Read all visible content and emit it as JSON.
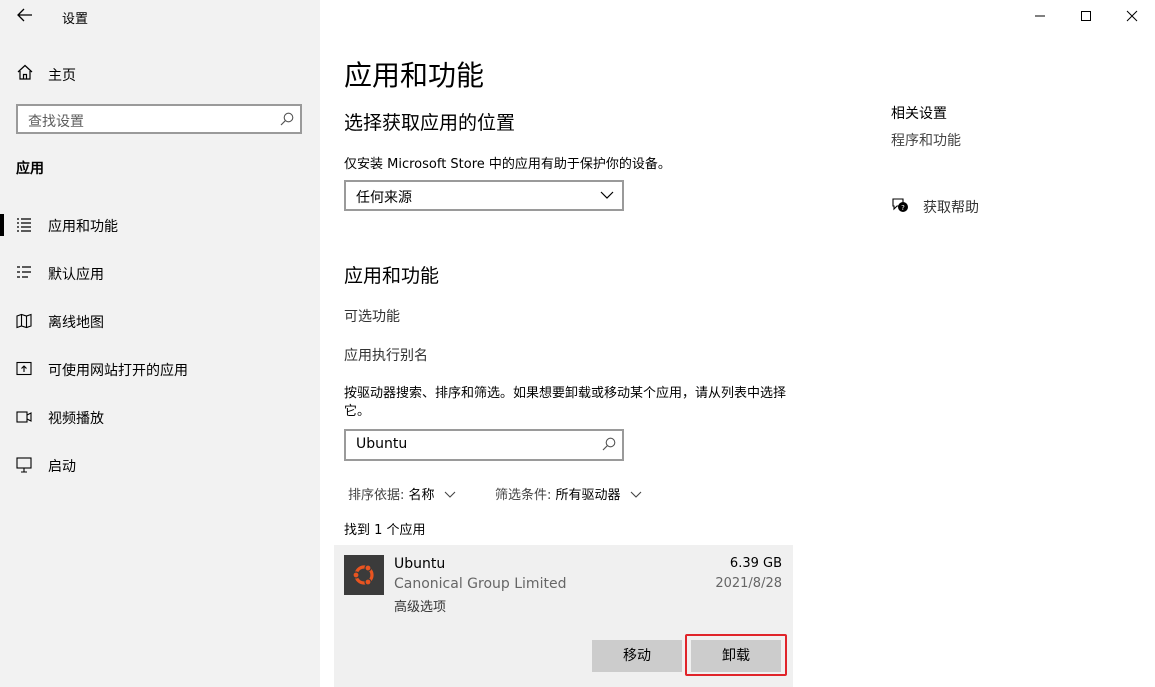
{
  "window": {
    "title": "设置",
    "minimize": "—",
    "maximize": "□",
    "close": "✕"
  },
  "sidebar": {
    "home_label": "主页",
    "search_placeholder": "查找设置",
    "section": "应用",
    "items": [
      {
        "label": "应用和功能",
        "icon": "apps-features-icon",
        "active": true
      },
      {
        "label": "默认应用",
        "icon": "default-apps-icon",
        "active": false
      },
      {
        "label": "离线地图",
        "icon": "offline-maps-icon",
        "active": false
      },
      {
        "label": "可使用网站打开的应用",
        "icon": "apps-for-websites-icon",
        "active": false
      },
      {
        "label": "视频播放",
        "icon": "video-playback-icon",
        "active": false
      },
      {
        "label": "启动",
        "icon": "startup-icon",
        "active": false
      }
    ]
  },
  "main": {
    "title": "应用和功能",
    "choose_section": {
      "heading": "选择获取应用的位置",
      "description": "仅安装 Microsoft Store 中的应用有助于保护你的设备。",
      "dropdown_value": "任何来源"
    },
    "apps_section": {
      "heading": "应用和功能",
      "optional_features": "可选功能",
      "app_aliases": "应用执行别名",
      "instructions": "按驱动器搜索、排序和筛选。如果想要卸载或移动某个应用，请从列表中选择它。",
      "search_value": "Ubuntu",
      "sort_label": "排序依据:",
      "sort_value": "名称",
      "filter_label": "筛选条件:",
      "filter_value": "所有驱动器",
      "found_text": "找到 1 个应用"
    },
    "app": {
      "name": "Ubuntu",
      "publisher": "Canonical Group Limited",
      "advanced": "高级选项",
      "size": "6.39 GB",
      "date": "2021/8/28",
      "move_button": "移动",
      "uninstall_button": "卸载",
      "icon_bg": "#3b3b3b",
      "icon_accent": "#e95420"
    }
  },
  "related": {
    "title": "相关设置",
    "programs_link": "程序和功能",
    "help_label": "获取帮助"
  },
  "colors": {
    "sidebar_bg": "#f2f2f2",
    "highlight": "#e0242a",
    "button_bg": "#cccccc"
  }
}
